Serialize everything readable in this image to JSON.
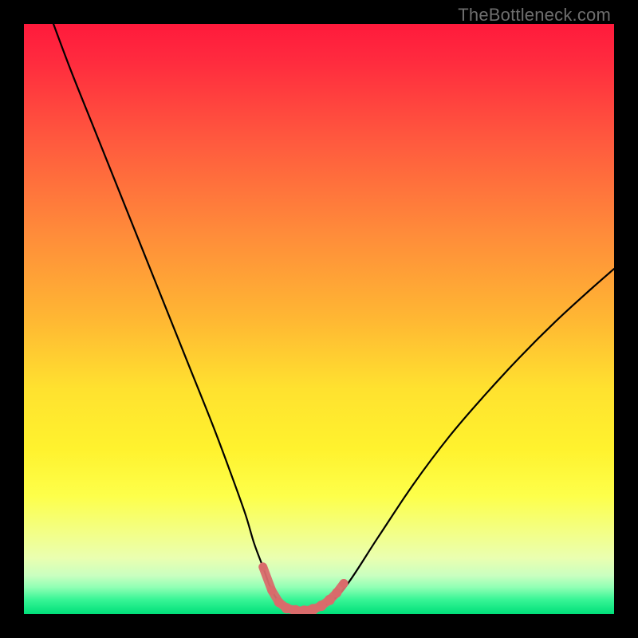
{
  "watermark": {
    "text": "TheBottleneck.com"
  },
  "colors": {
    "black": "#000000",
    "curve": "#000000",
    "marker": "#d96b6b",
    "gradient_stops": [
      {
        "offset": 0.0,
        "color": "#ff1a3c"
      },
      {
        "offset": 0.06,
        "color": "#ff2a3e"
      },
      {
        "offset": 0.2,
        "color": "#ff5a3e"
      },
      {
        "offset": 0.35,
        "color": "#ff8a3a"
      },
      {
        "offset": 0.5,
        "color": "#ffb733"
      },
      {
        "offset": 0.62,
        "color": "#ffe22f"
      },
      {
        "offset": 0.72,
        "color": "#fff22e"
      },
      {
        "offset": 0.8,
        "color": "#fdff4a"
      },
      {
        "offset": 0.86,
        "color": "#f3ff85"
      },
      {
        "offset": 0.905,
        "color": "#eaffb0"
      },
      {
        "offset": 0.935,
        "color": "#c9ffc0"
      },
      {
        "offset": 0.955,
        "color": "#8fffb4"
      },
      {
        "offset": 0.975,
        "color": "#39f596"
      },
      {
        "offset": 1.0,
        "color": "#00e07a"
      }
    ]
  },
  "chart_data": {
    "type": "line",
    "title": "",
    "xlabel": "",
    "ylabel": "",
    "xlim": [
      0,
      100
    ],
    "ylim": [
      0,
      100
    ],
    "grid": false,
    "series": [
      {
        "name": "bottleneck-curve",
        "x": [
          5,
          8,
          12,
          16,
          20,
          24,
          28,
          32,
          35,
          37.5,
          39,
          40.5,
          42,
          44,
          46,
          48,
          50,
          54,
          60,
          66,
          72,
          78,
          84,
          90,
          96,
          100
        ],
        "y": [
          100,
          92,
          82,
          72,
          62,
          52,
          42,
          32,
          24,
          17,
          12,
          8,
          4,
          1.2,
          0.5,
          0.5,
          1.0,
          4,
          13,
          22,
          30,
          37,
          43.5,
          49.5,
          55,
          58.5
        ]
      }
    ],
    "markers": {
      "name": "optimal-range",
      "x": [
        40.5,
        42,
        43.2,
        44.5,
        46,
        47.5,
        49,
        50.4,
        51.8,
        53,
        54.2
      ],
      "y": [
        8,
        4,
        2,
        1,
        0.6,
        0.5,
        0.8,
        1.4,
        2.4,
        3.6,
        5.2
      ],
      "r": [
        5,
        5.5,
        6,
        6.5,
        6.8,
        7,
        6.8,
        6.5,
        6.5,
        6,
        5.5
      ]
    }
  }
}
